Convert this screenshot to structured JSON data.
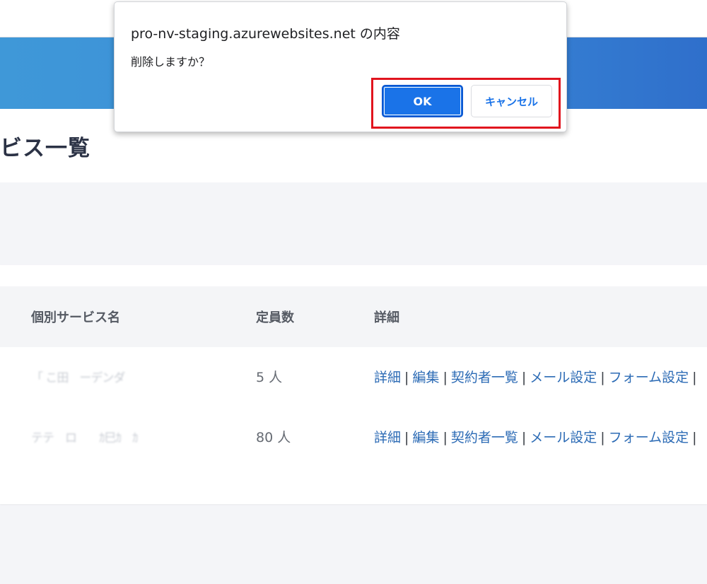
{
  "dialog": {
    "title": "pro-nv-staging.azurewebsites.net の内容",
    "message": "削除しますか？",
    "ok_label": "OK",
    "cancel_label": "キャンセル"
  },
  "page": {
    "title": "ビス一覧"
  },
  "table": {
    "headers": {
      "name": "個別サービス名",
      "capacity": "定員数",
      "details": "詳細"
    },
    "rows": [
      {
        "name": "「 こ田　ーデンダ",
        "capacity": "5 人"
      },
      {
        "name": "テテ　ロ　　ｶ巳ｶ　ｶ",
        "capacity": "80 人"
      }
    ],
    "link_labels": [
      "詳細",
      "編集",
      "契約者一覧",
      "メール設定",
      "フォーム設定"
    ],
    "separator": "|"
  },
  "colors": {
    "banner_start": "#3f98d8",
    "banner_end": "#2f6fcb",
    "link": "#2c6bb5",
    "ok_button": "#1a73e8",
    "highlight": "#e1141e"
  }
}
